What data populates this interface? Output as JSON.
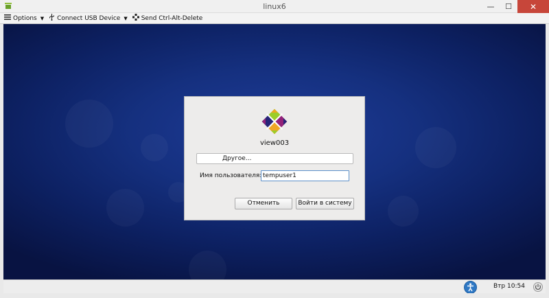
{
  "window": {
    "title": "linux6",
    "minimize_glyph": "—",
    "maximize_glyph": "☐",
    "close_glyph": "✕"
  },
  "toolbar": {
    "options_label": "Options",
    "usb_label": "Connect USB Device",
    "cad_label": "Send Ctrl-Alt-Delete",
    "dropdown_glyph": "▼"
  },
  "login": {
    "hostname": "view003",
    "user_option": "Другое...",
    "username_label": "Имя пользователя:",
    "username_value": "tempuser1",
    "cancel_label": "Отменить",
    "login_label": "Войти в систему"
  },
  "panel": {
    "clock": "Втр 10:54"
  },
  "icons": {
    "app": "vm-console-icon",
    "options": "hamburger-menu-icon",
    "usb": "usb-icon",
    "cad": "ctrl-alt-delete-icon",
    "logo": "centos-logo",
    "accessibility": "accessibility-icon",
    "power": "power-icon"
  },
  "colors": {
    "desktop_center": "#1e3b98",
    "desktop_edge": "#081342",
    "close_button": "#c7463a",
    "accessibility": "#2f78c4",
    "input_focus": "#5b8fc9"
  }
}
